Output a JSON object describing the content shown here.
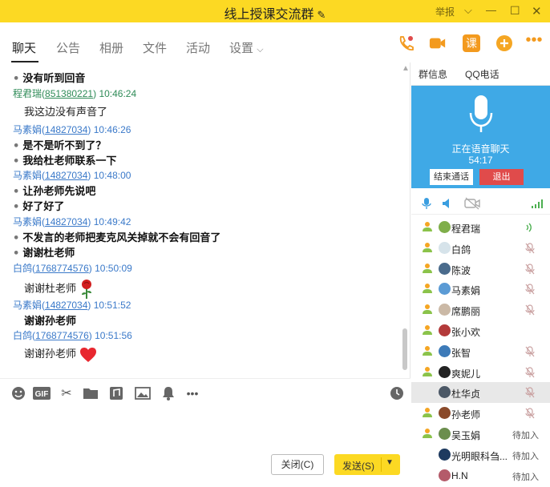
{
  "window": {
    "title": "线上授课交流群",
    "report": "举报",
    "controls": [
      "minimize",
      "maximize",
      "close"
    ]
  },
  "tabs": [
    {
      "label": "聊天",
      "active": true
    },
    {
      "label": "公告"
    },
    {
      "label": "相册"
    },
    {
      "label": "文件"
    },
    {
      "label": "活动"
    },
    {
      "label": "设置"
    }
  ],
  "toolbar_icons": [
    "phone-icon",
    "video-call-icon",
    "lesson-icon",
    "add-icon",
    "more-icon"
  ],
  "chat": {
    "partial_top": "没有听到回音",
    "messages": [
      {
        "sender": "程君瑞",
        "qq": "851380221",
        "time": "10:46:24",
        "lines": [
          "我这边没有声音了"
        ],
        "style": "plain"
      },
      {
        "sender": "马素娟",
        "qq": "14827034",
        "time": "10:46:26",
        "lines": [
          "是不是听不到了？",
          "我给杜老师联系一下"
        ],
        "style": "hand"
      },
      {
        "sender": "马素娟",
        "qq": "14827034",
        "time": "10:48:00",
        "lines": [
          "让孙老师先说吧",
          "好了好了"
        ],
        "style": "hand"
      },
      {
        "sender": "马素娟",
        "qq": "14827034",
        "time": "10:49:42",
        "lines": [
          "不发言的老师把麦克风关掉就不会有回音了",
          "谢谢杜老师"
        ],
        "style": "hand"
      },
      {
        "sender": "白鸽",
        "qq": "1768774576",
        "time": "10:50:09",
        "lines": [
          "谢谢杜老师"
        ],
        "style": "plain",
        "emoji": "rose"
      },
      {
        "sender": "马素娟",
        "qq": "14827034",
        "time": "10:51:52",
        "lines": [
          "谢谢孙老师"
        ],
        "style": "hand"
      },
      {
        "sender": "白鸽",
        "qq": "1768774576",
        "time": "10:51:56",
        "lines": [
          "谢谢孙老师"
        ],
        "style": "plain",
        "emoji": "heart"
      }
    ]
  },
  "input_toolbar": [
    "emoji-icon",
    "gif-icon",
    "scissors-icon",
    "folder-icon",
    "music-icon",
    "image-icon",
    "bell-icon",
    "more-icon",
    "history-icon"
  ],
  "buttons": {
    "close": "关闭(C)",
    "send": "发送(S)"
  },
  "right_panel": {
    "tabs": [
      "群信息",
      "QQ电话"
    ],
    "voice": {
      "status": "正在语音聊天",
      "duration": "54:17",
      "end_label": "结束通话",
      "exit_label": "退出"
    },
    "members": [
      {
        "name": "程君瑞",
        "status": "speaking",
        "avatar": "#7fae4a"
      },
      {
        "name": "白鸽",
        "status": "muted",
        "avatar": "#d6e3ea"
      },
      {
        "name": "陈波",
        "status": "muted",
        "avatar": "#4a6b8c"
      },
      {
        "name": "马素娟",
        "status": "muted",
        "avatar": "#5b9bd5"
      },
      {
        "name": "席鹏丽",
        "status": "muted",
        "avatar": "#cbb9a6"
      },
      {
        "name": "张小欢",
        "status": "none",
        "avatar": "#b33a3a"
      },
      {
        "name": "张智",
        "status": "muted",
        "avatar": "#3d7ab8"
      },
      {
        "name": "爽妮儿",
        "status": "muted",
        "avatar": "#222222"
      },
      {
        "name": "杜华贞",
        "status": "muted",
        "avatar": "#4c5866",
        "selected": true
      },
      {
        "name": "孙老师",
        "status": "muted",
        "avatar": "#8a4a2a"
      },
      {
        "name": "吴玉娟",
        "status": "pending",
        "avatar": "#6b8e4e",
        "pending_label": "待加入"
      },
      {
        "name": "光明眼科刍...",
        "status": "pending",
        "avatar": "#1e3a5f",
        "pending_label": "待加入"
      },
      {
        "name": "H.N",
        "status": "pending",
        "avatar": "#b45b6a",
        "pending_label": "待加入"
      }
    ]
  }
}
